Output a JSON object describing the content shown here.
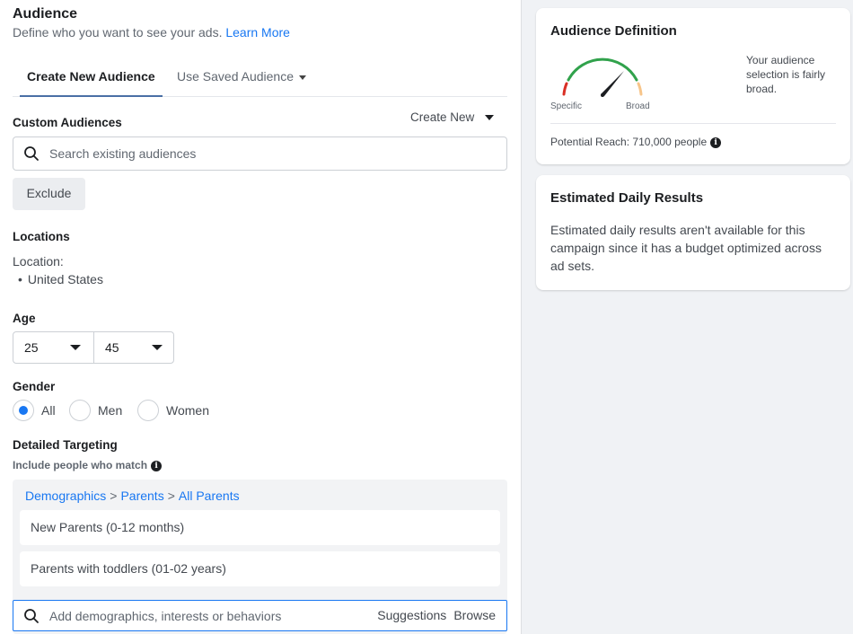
{
  "header": {
    "title": "Audience",
    "subtitle": "Define who you want to see your ads.",
    "learn_more": "Learn More"
  },
  "tabs": [
    {
      "label": "Create New Audience",
      "active": true
    },
    {
      "label": "Use Saved Audience",
      "active": false
    }
  ],
  "custom_audiences": {
    "label": "Custom Audiences",
    "create_new": "Create New",
    "search_placeholder": "Search existing audiences",
    "exclude_label": "Exclude"
  },
  "locations": {
    "label": "Locations",
    "location_label": "Location:",
    "items": [
      "United States"
    ]
  },
  "age": {
    "label": "Age",
    "min": "25",
    "max": "45"
  },
  "gender": {
    "label": "Gender",
    "options": [
      {
        "label": "All",
        "selected": true
      },
      {
        "label": "Men",
        "selected": false
      },
      {
        "label": "Women",
        "selected": false
      }
    ]
  },
  "detailed_targeting": {
    "label": "Detailed Targeting",
    "include_label": "Include people who match",
    "breadcrumb": [
      "Demographics",
      "Parents",
      "All Parents"
    ],
    "items": [
      "New Parents (0-12 months)",
      "Parents with toddlers (01-02 years)"
    ],
    "search_placeholder": "Add demographics, interests or behaviors",
    "suggestions": "Suggestions",
    "browse": "Browse"
  },
  "audience_definition": {
    "title": "Audience Definition",
    "gauge_left": "Specific",
    "gauge_right": "Broad",
    "description": "Your audience selection is fairly broad.",
    "potential_reach": "Potential Reach: 710,000 people"
  },
  "estimated_daily": {
    "title": "Estimated Daily Results",
    "text": "Estimated daily results aren't available for this campaign since it has a budget optimized across ad sets."
  },
  "colors": {
    "accent": "#1877f2",
    "gauge_red": "#d93025",
    "gauge_green": "#31a24c",
    "gauge_orange": "#f7b928"
  }
}
